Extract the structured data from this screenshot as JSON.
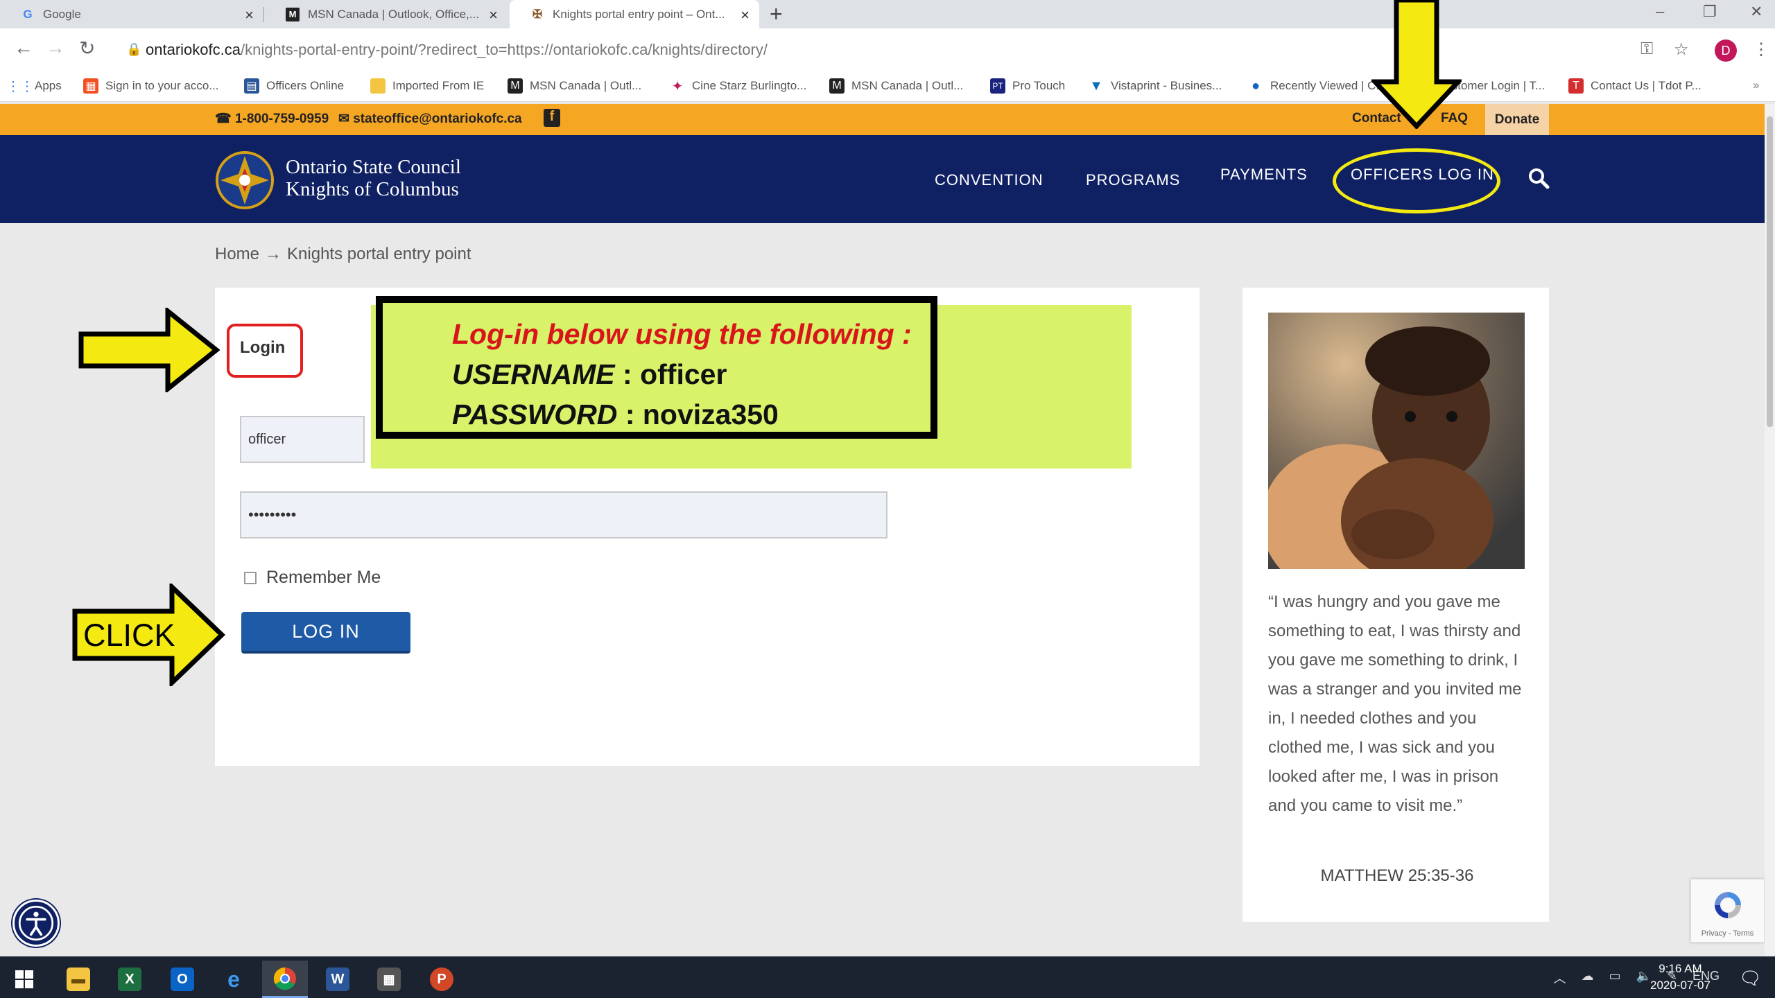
{
  "browser": {
    "tabs": [
      {
        "title": "Google",
        "icon": "google-icon",
        "active": false
      },
      {
        "title": "MSN Canada | Outlook, Office,...",
        "icon": "msn-icon",
        "active": false
      },
      {
        "title": "Knights portal entry point – Ont...",
        "icon": "kofc-icon",
        "active": true
      }
    ],
    "new_tab": "+",
    "url_host": "ontariokofc.ca",
    "url_path": "/knights-portal-entry-point/?redirect_to=https://ontariokofc.ca/knights/directory/",
    "profile_initial": "D",
    "bookmarks": [
      {
        "label": "Apps",
        "icon_color": "#4285f4"
      },
      {
        "label": "Sign in to your acco...",
        "icon_color": "#f25022"
      },
      {
        "label": "Officers Online",
        "icon_color": "#2b579a"
      },
      {
        "label": "Imported From IE",
        "icon_color": "#f4c542"
      },
      {
        "label": "MSN Canada | Outl...",
        "icon_color": "#222222"
      },
      {
        "label": "Cine Starz Burlingto...",
        "icon_color": "#c2185b"
      },
      {
        "label": "MSN Canada | Outl...",
        "icon_color": "#222222"
      },
      {
        "label": "Pro Touch",
        "icon_color": "#1a237e"
      },
      {
        "label": "Vistaprint - Busines...",
        "icon_color": "#0b6fb6"
      },
      {
        "label": "Recently Viewed | C...",
        "icon_color": "#1565c0"
      },
      {
        "label": "Customer Login | T...",
        "icon_color": "#607d8b"
      },
      {
        "label": "Contact Us | Tdot P...",
        "icon_color": "#d32f2f"
      }
    ]
  },
  "topbar": {
    "phone": "1-800-759-0959",
    "email": "stateoffice@ontariokofc.ca",
    "contact": "Contact",
    "faq": "FAQ",
    "donate": "Donate"
  },
  "header": {
    "logo_line1": "Ontario State Council",
    "logo_line2": "Knights of Columbus",
    "nav": [
      "CONVENTION",
      "PROGRAMS",
      "PAYMENTS",
      "OFFICERS LOG IN"
    ]
  },
  "breadcrumb": {
    "home": "Home",
    "separator": "→",
    "current": "Knights portal entry point"
  },
  "login": {
    "title": "Login",
    "username_value": "officer",
    "password_value": "•••••••••",
    "remember_label": "Remember Me",
    "button_label": "LOG IN"
  },
  "annotation": {
    "line1": "Log-in below using the following :",
    "username_label": "USERNAME",
    "username_value": ": officer",
    "password_label": "PASSWORD",
    "password_value": ": noviza350",
    "click_label": "CLICK",
    "highlight_color": "#f4ea12",
    "note_color": "#d8f26a"
  },
  "sidebar": {
    "quote": "“I was hungry and you gave me something to eat, I was thirsty and you gave me something to drink, I was a stranger and you invited me in, I needed clothes and you clothed me, I was sick and you looked after me, I was in prison and you came to visit me.”",
    "citation": "MATTHEW 25:35-36"
  },
  "recaptcha": {
    "text": "Privacy - Terms"
  },
  "taskbar": {
    "lang": "ENG",
    "time": "9:16 AM",
    "date": "2020-07-07"
  },
  "colors": {
    "brand_navy": "#0f2163",
    "brand_orange": "#f5a623",
    "button_blue": "#1f5aa6"
  }
}
